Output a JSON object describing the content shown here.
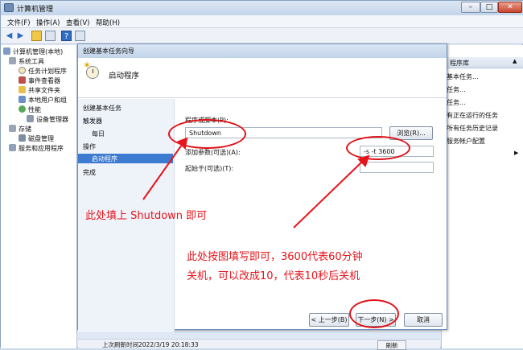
{
  "window": {
    "title": "计算机管理",
    "controls": [
      "–",
      "□",
      "✕"
    ]
  },
  "menu": [
    "文件(F)",
    "操作(A)",
    "查看(V)",
    "帮助(H)"
  ],
  "tree": {
    "root": "计算机管理(本地)",
    "system_tools": "系统工具",
    "task_scheduler": "任务计划程序",
    "event_viewer": "事件查看器",
    "shared_folders": "共享文件夹",
    "local_users": "本地用户和组",
    "performance": "性能",
    "device_manager": "设备管理器",
    "storage": "存储",
    "disk_mgmt": "磁盘管理",
    "services_apps": "服务和应用程序"
  },
  "actions": {
    "header": "程序库",
    "items": [
      "基本任务...",
      "任务...",
      "任务...",
      "有正在运行的任务",
      "所有任务历史记录",
      "服务帐户配置"
    ]
  },
  "wizard": {
    "title": "创建基本任务向导",
    "heading": "启动程序",
    "steps": [
      "创建基本任务",
      "触发器",
      "每日",
      "操作",
      "启动程序",
      "完成"
    ],
    "program_label": "程序或脚本(P):",
    "program_value": "Shutdown",
    "browse_label": "浏览(R)...",
    "args_label": "添加参数(可选)(A):",
    "args_value": "-s -t 3600",
    "startin_label": "起始于(可选)(T):",
    "startin_value": "",
    "back_label": "< 上一步(B)",
    "next_label": "下一步(N) >",
    "cancel_label": "取消"
  },
  "statusbar": {
    "text": "上次刷新时间2022/3/19 20:18:33",
    "refresh": "刷新"
  },
  "annotations": {
    "a1": "此处填上 Shutdown 即可",
    "a2_line1": "此处按图填写即可，3600代表60分钟",
    "a2_line2": "关机，可以改成10，代表10秒后关机"
  },
  "colors": {
    "annotation": "#e8141b",
    "selection": "#3d7bd1"
  }
}
